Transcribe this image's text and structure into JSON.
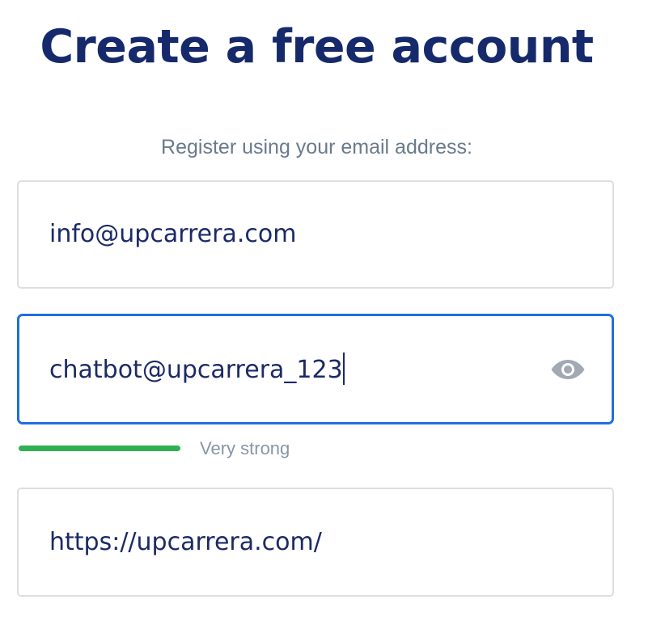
{
  "header": {
    "title": "Create a free account",
    "subtitle": "Register using your email address:"
  },
  "form": {
    "email": {
      "value": "info@upcarrera.com"
    },
    "password": {
      "value": "chatbot@upcarrera_123",
      "toggle_icon": "eye-icon",
      "strength_label": "Very strong",
      "strength_level": 1.0,
      "strength_color": "#2fb052"
    },
    "website": {
      "value": "https://upcarrera.com/"
    }
  },
  "colors": {
    "title": "#162a6b",
    "focus_border": "#1f6fe0",
    "field_border": "#dcdee2"
  }
}
